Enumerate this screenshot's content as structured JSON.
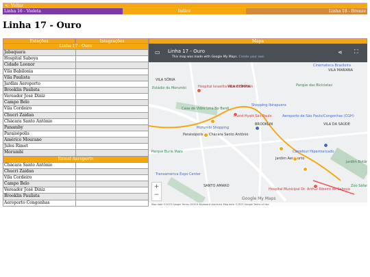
{
  "nav": {
    "back": "<- Voltar",
    "prev_line": "Linha 16 - Violeta",
    "index": "Índice",
    "next_line": "Linha 18 - Bronze"
  },
  "page_title": "Linha 17 - Ouro",
  "headers": {
    "stations": "Estações",
    "integrations": "Integrações",
    "map": "Mapa"
  },
  "line_label": "Linha 17 - Ouro",
  "stations": [
    "Jabaquara",
    "Hospital Saboya",
    "Cidade Leonor",
    "Vila Babilonia",
    "Vila Paulista",
    "Jardim Aeroporto",
    "Brooklin Paulista",
    "Vereador José Diniz",
    "Campo Belo",
    "Vila Cordeiro",
    "Chucri Zaidan",
    "Chácara Santo Antônio",
    "Panamby",
    "Paraisópolis",
    "Américo Mourano",
    "Jules Rimet",
    "Morumbi"
  ],
  "branch_label": "Ramal Aeroporto",
  "branch_stations": [
    "Chácara Santo Antônio",
    "Chucri Zaidan",
    "Vila Cordeiro",
    "Campo Belo",
    "Vereador José Diniz",
    "Brooklin Paulista",
    "Aeroporto Congonhas"
  ],
  "map": {
    "title": "Linha 17 - Ouro",
    "notice_prefix": "This map was made with Google My Maps.",
    "notice_link": "Create your own",
    "footer": "Map data ©2023 Google  Terms  1000 ft        Keyboard shortcuts  Map data ©2023 Google  Terms of Use",
    "google_logo": "Google My Maps",
    "labels": [
      {
        "t": "VILA SÔNIA",
        "c": "#333"
      },
      {
        "t": "VILA OLÍMPIA",
        "c": "#333"
      },
      {
        "t": "VILA MARIANA",
        "c": "#333"
      },
      {
        "t": "Estádio do Morumbi",
        "c": "#2a8a4a"
      },
      {
        "t": "Hospital Israelita Albert Einstein",
        "c": "#d33"
      },
      {
        "t": "Shopping Ibirapuera",
        "c": "#46c"
      },
      {
        "t": "Parque das Bicicletas",
        "c": "#2a8a4a"
      },
      {
        "t": "Casa de Vidro Lina Bo Bardi",
        "c": "#2a8a4a"
      },
      {
        "t": "Grand Hyatt São Paulo",
        "c": "#d33"
      },
      {
        "t": "Morumbi Shopping",
        "c": "#46c"
      },
      {
        "t": "BROOKLIN",
        "c": "#333"
      },
      {
        "t": "Paraisópolis",
        "c": "#333"
      },
      {
        "t": "Chácara Santo Antônio",
        "c": "#333"
      },
      {
        "t": "Aeroporto de São Paulo/Congonhas (CGH)",
        "c": "#46c"
      },
      {
        "t": "VILA DA SAÚDE",
        "c": "#333"
      },
      {
        "t": "Parque Burle Marx",
        "c": "#2a8a4a"
      },
      {
        "t": "Carrefour Hipermercado",
        "c": "#46c"
      },
      {
        "t": "Jardim Aeroporto",
        "c": "#333"
      },
      {
        "t": "SANTO AMARO",
        "c": "#333"
      },
      {
        "t": "Transamérica Expo Center",
        "c": "#46c"
      },
      {
        "t": "Hospital Municipal Dr. Arthur Ribeiro de Saboya",
        "c": "#d33"
      },
      {
        "t": "Jardim Botânico de São Paulo",
        "c": "#2a8a4a"
      },
      {
        "t": "Zoo Sáfari",
        "c": "#2a8a4a"
      },
      {
        "t": "Cinemateca Brasileira",
        "c": "#46c"
      }
    ]
  }
}
